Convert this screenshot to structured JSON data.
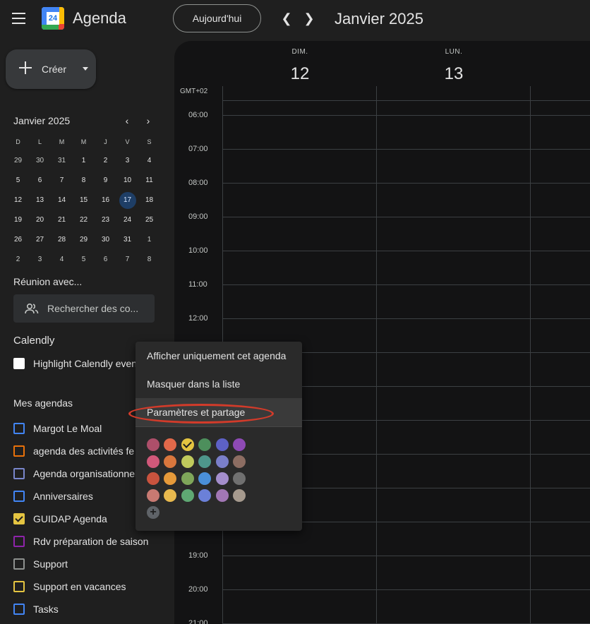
{
  "header": {
    "app_title": "Agenda",
    "logo_text": "24",
    "today_label": "Aujourd'hui",
    "prev_icon": "chevron-left-icon",
    "next_icon": "chevron-right-icon",
    "month_title": "Janvier 2025"
  },
  "sidebar": {
    "create_label": "Créer",
    "mini_calendar": {
      "title": "Janvier 2025",
      "weekdays": [
        "D",
        "L",
        "M",
        "M",
        "J",
        "V",
        "S"
      ],
      "weeks": [
        [
          "29",
          "30",
          "31",
          "1",
          "2",
          "3",
          "4"
        ],
        [
          "5",
          "6",
          "7",
          "8",
          "9",
          "10",
          "11"
        ],
        [
          "12",
          "13",
          "14",
          "15",
          "16",
          "17",
          "18"
        ],
        [
          "19",
          "20",
          "21",
          "22",
          "23",
          "24",
          "25"
        ],
        [
          "26",
          "27",
          "28",
          "29",
          "30",
          "31",
          "1"
        ],
        [
          "2",
          "3",
          "4",
          "5",
          "6",
          "7",
          "8"
        ]
      ],
      "today": "17"
    },
    "meet_title": "Réunion avec...",
    "people_search_placeholder": "Rechercher des co...",
    "calendly_title": "Calendly",
    "calendly_item": "Highlight Calendly events",
    "my_calendars_title": "Mes agendas",
    "my_calendars": [
      {
        "name": "Margot Le Moal",
        "color": "#4285f4",
        "checked": false
      },
      {
        "name": "agenda des activités fe",
        "color": "#e8710a",
        "checked": false
      },
      {
        "name": "Agenda organisationnel",
        "color": "#7986cb",
        "checked": false
      },
      {
        "name": "Anniversaires",
        "color": "#4285f4",
        "checked": false
      },
      {
        "name": "GUIDAP Agenda",
        "color": "#e4c441",
        "checked": true
      },
      {
        "name": "Rdv préparation de saison",
        "color": "#8e24aa",
        "checked": false
      },
      {
        "name": "Support",
        "color": "#8e918f",
        "checked": false
      },
      {
        "name": "Support en vacances",
        "color": "#e4c441",
        "checked": false
      },
      {
        "name": "Tasks",
        "color": "#4285f4",
        "checked": false
      }
    ]
  },
  "main": {
    "days": [
      {
        "dow": "DIM.",
        "num": "12"
      },
      {
        "dow": "LUN.",
        "num": "13"
      }
    ],
    "timezone": "GMT+02",
    "hours": [
      "06:00",
      "07:00",
      "08:00",
      "09:00",
      "10:00",
      "11:00",
      "12:00",
      "",
      "",
      "",
      "",
      "",
      "",
      "19:00",
      "20:00",
      "21:00"
    ]
  },
  "context_menu": {
    "items": [
      "Afficher uniquement cet agenda",
      "Masquer dans la liste",
      "Paramètres et partage"
    ],
    "colors": [
      [
        "#ad4f6a",
        "#e2694a",
        "#e4c441",
        "#4d8f5c",
        "#5d61c5",
        "#8e4ab5"
      ],
      [
        "#d1587a",
        "#d9773d",
        "#c0ca5c",
        "#4e968b",
        "#7a7fc9",
        "#8c6d62"
      ],
      [
        "#c9533e",
        "#e69a3a",
        "#7fa65a",
        "#4a8fd9",
        "#a48ecc",
        "#707070"
      ],
      [
        "#c87a72",
        "#e8b94e",
        "#5fa873",
        "#6b80d8",
        "#a277b5",
        "#a69a8e"
      ]
    ],
    "selected_color": "#e4c441",
    "add_color_label": "+"
  }
}
